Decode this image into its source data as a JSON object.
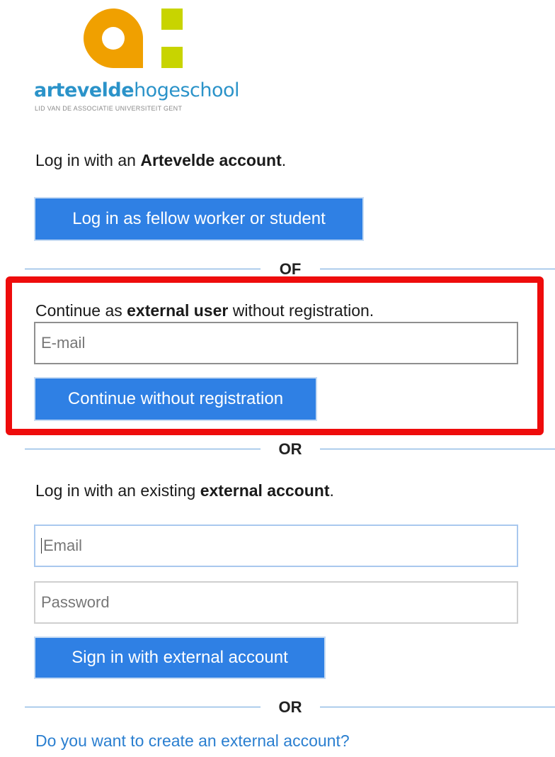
{
  "logo": {
    "word_bold": "artevelde",
    "word_light": "hogeschool",
    "subtitle": "LID VAN DE ASSOCIATIE UNIVERSITEIT GENT",
    "colors": {
      "orange": "#f0a000",
      "green": "#c8d400",
      "blue": "#2b93c9"
    }
  },
  "artevelde_section": {
    "intro_prefix": "Log in with an ",
    "intro_bold": "Artevelde account",
    "intro_suffix": ".",
    "button_label": "Log in as fellow worker or student"
  },
  "divider_1": {
    "label": "OF"
  },
  "guest_section": {
    "intro_prefix": "Continue as ",
    "intro_bold": "external user",
    "intro_suffix": " without registration.",
    "email_placeholder": "E-mail",
    "email_value": "",
    "button_label": "Continue without registration"
  },
  "divider_2": {
    "label": "OR"
  },
  "external_section": {
    "intro_prefix": "Log in with an existing ",
    "intro_bold": "external account",
    "intro_suffix": ".",
    "email_placeholder": "Email",
    "email_value": "",
    "password_placeholder": "Password",
    "password_value": "",
    "button_label": "Sign in with external account"
  },
  "divider_3": {
    "label": "OR"
  },
  "create_account_link": "Do you want to create an external account?",
  "colors": {
    "button_bg": "#2f80e4",
    "highlight_border": "#ee0c0c",
    "link": "#2b7fd0",
    "divider": "#6aa3dc"
  }
}
